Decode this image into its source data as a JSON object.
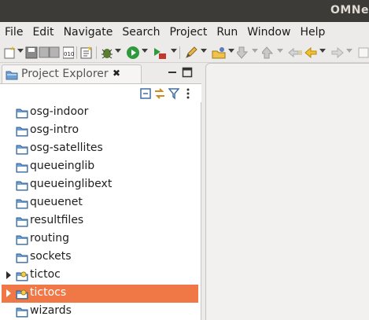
{
  "window": {
    "title": "OMNe"
  },
  "menubar": [
    "File",
    "Edit",
    "Navigate",
    "Search",
    "Project",
    "Run",
    "Window",
    "Help"
  ],
  "explorer": {
    "tab_label": "Project Explorer",
    "close_glyph": "✖",
    "items": [
      {
        "label": "osg-indoor",
        "expandable": false,
        "selected": false,
        "icon": "folder-icon"
      },
      {
        "label": "osg-intro",
        "expandable": false,
        "selected": false,
        "icon": "folder-icon"
      },
      {
        "label": "osg-satellites",
        "expandable": false,
        "selected": false,
        "icon": "folder-icon"
      },
      {
        "label": "queueinglib",
        "expandable": false,
        "selected": false,
        "icon": "folder-icon"
      },
      {
        "label": "queueinglibext",
        "expandable": false,
        "selected": false,
        "icon": "folder-icon"
      },
      {
        "label": "queuenet",
        "expandable": false,
        "selected": false,
        "icon": "folder-icon"
      },
      {
        "label": "resultfiles",
        "expandable": false,
        "selected": false,
        "icon": "folder-icon"
      },
      {
        "label": "routing",
        "expandable": false,
        "selected": false,
        "icon": "folder-icon"
      },
      {
        "label": "sockets",
        "expandable": false,
        "selected": false,
        "icon": "folder-icon"
      },
      {
        "label": "tictoc",
        "expandable": true,
        "selected": false,
        "icon": "open-project-icon"
      },
      {
        "label": "tictocs",
        "expandable": true,
        "selected": true,
        "icon": "open-project-icon"
      },
      {
        "label": "wizards",
        "expandable": false,
        "selected": false,
        "icon": "folder-icon"
      }
    ]
  },
  "colors": {
    "selection": "#f07746",
    "titlebar": "#3c3b37",
    "folder": "#6f9fd0"
  }
}
